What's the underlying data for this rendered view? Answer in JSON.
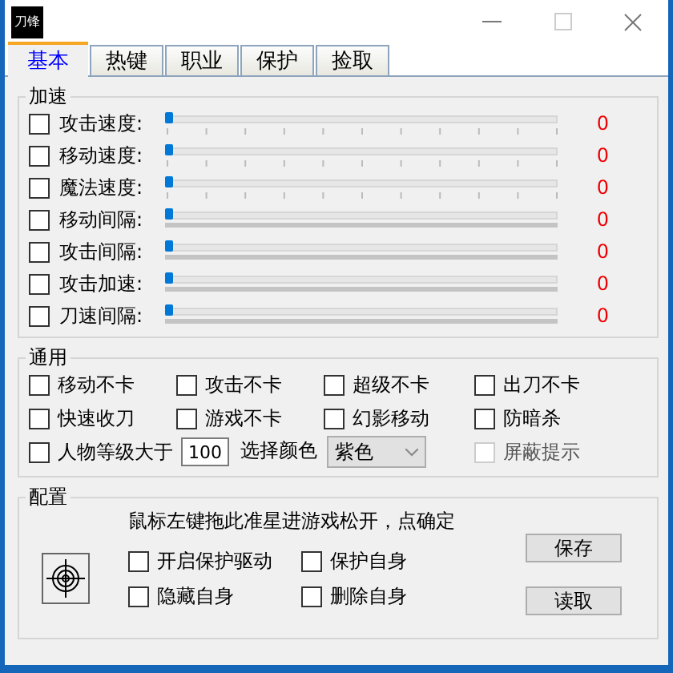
{
  "window": {
    "logo": "刀锋"
  },
  "tabs": [
    {
      "label": "基本",
      "selected": true
    },
    {
      "label": "热键",
      "selected": false
    },
    {
      "label": "职业",
      "selected": false
    },
    {
      "label": "保护",
      "selected": false
    },
    {
      "label": "捡取",
      "selected": false
    }
  ],
  "speed_group": {
    "title": "加速",
    "rows": [
      {
        "label": "攻击速度:",
        "checked": false,
        "kind": "ticks",
        "level": 0,
        "reading": "0"
      },
      {
        "label": "移动速度:",
        "checked": false,
        "kind": "ticks",
        "level": 0,
        "reading": "0"
      },
      {
        "label": "魔法速度:",
        "checked": false,
        "kind": "ticks",
        "level": 0,
        "reading": "0"
      },
      {
        "label": "移动间隔:",
        "checked": false,
        "kind": "bar",
        "level": 0,
        "reading": "0"
      },
      {
        "label": "攻击间隔:",
        "checked": false,
        "kind": "bar",
        "level": 0,
        "reading": "0"
      },
      {
        "label": "攻击加速:",
        "checked": false,
        "kind": "bar",
        "level": 0,
        "reading": "0"
      },
      {
        "label": "刀速间隔:",
        "checked": false,
        "kind": "bar",
        "level": 0,
        "reading": "0"
      }
    ]
  },
  "general_group": {
    "title": "通用",
    "options": [
      {
        "label": "移动不卡",
        "checked": false,
        "disabled": false
      },
      {
        "label": "攻击不卡",
        "checked": false,
        "disabled": false
      },
      {
        "label": "超级不卡",
        "checked": false,
        "disabled": false
      },
      {
        "label": "出刀不卡",
        "checked": false,
        "disabled": false
      },
      {
        "label": "快速收刀",
        "checked": false,
        "disabled": false
      },
      {
        "label": "游戏不卡",
        "checked": false,
        "disabled": false
      },
      {
        "label": "幻影移动",
        "checked": false,
        "disabled": false
      },
      {
        "label": "防暗杀",
        "checked": false,
        "disabled": false
      }
    ],
    "level_option": {
      "label": "人物等级大于",
      "checked": false,
      "value": "100"
    },
    "color_label": "选择颜色",
    "color_select": {
      "value": "紫色"
    },
    "hide_tip": {
      "label": "屏蔽提示",
      "checked": false,
      "disabled": true
    }
  },
  "config_group": {
    "title": "配置",
    "hint": "鼠标左键拖此准星进游戏松开，点确定",
    "options": [
      {
        "label": "开启保护驱动",
        "checked": false
      },
      {
        "label": "保护自身",
        "checked": false
      },
      {
        "label": "隐藏自身",
        "checked": false
      },
      {
        "label": "删除自身",
        "checked": false
      }
    ],
    "buttons": [
      "保存",
      "读取"
    ]
  }
}
